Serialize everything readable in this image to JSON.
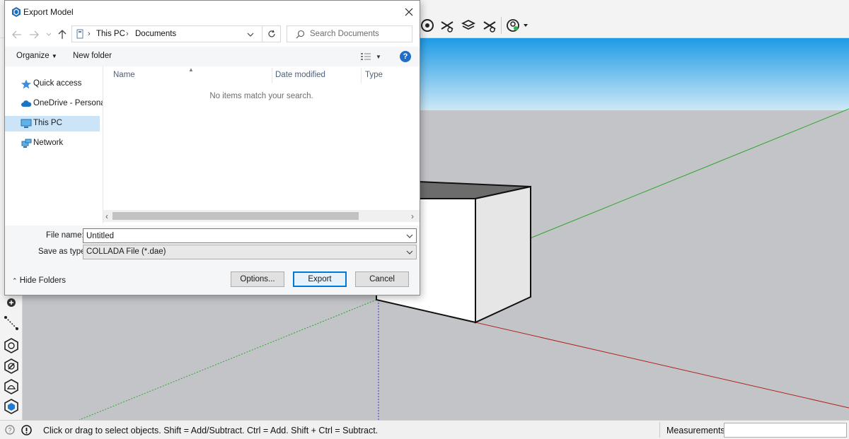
{
  "dialog": {
    "title": "Export Model",
    "address": {
      "crumbs": [
        "This PC",
        "Documents"
      ]
    },
    "search": {
      "placeholder": "Search Documents"
    },
    "commands": {
      "organize": "Organize",
      "new_folder": "New folder"
    },
    "nav_items": [
      {
        "label": "Quick access",
        "icon": "star-icon"
      },
      {
        "label": "OneDrive - Personal",
        "icon": "cloud-icon"
      },
      {
        "label": "This PC",
        "icon": "computer-icon",
        "selected": true
      },
      {
        "label": "Network",
        "icon": "network-icon"
      }
    ],
    "columns": [
      "Name",
      "Date modified",
      "Type"
    ],
    "empty_message": "No items match your search.",
    "file_name_label": "File name:",
    "file_name_value": "Untitled",
    "save_type_label": "Save as type:",
    "save_type_value": "COLLADA File (*.dae)",
    "hide_folders": "Hide Folders",
    "buttons": {
      "options": "Options...",
      "export": "Export",
      "cancel": "Cancel"
    }
  },
  "status_bar": {
    "message": "Click or drag to select objects. Shift = Add/Subtract. Ctrl = Add. Shift + Ctrl = Subtract.",
    "measurements_label": "Measurements",
    "measurements_value": ""
  },
  "colors": {
    "sky_top": "#1e9be6",
    "sky_bottom": "#cde8f6",
    "ground": "#c3c4c8",
    "accent": "#0078d7",
    "selection": "#cce4f7"
  }
}
